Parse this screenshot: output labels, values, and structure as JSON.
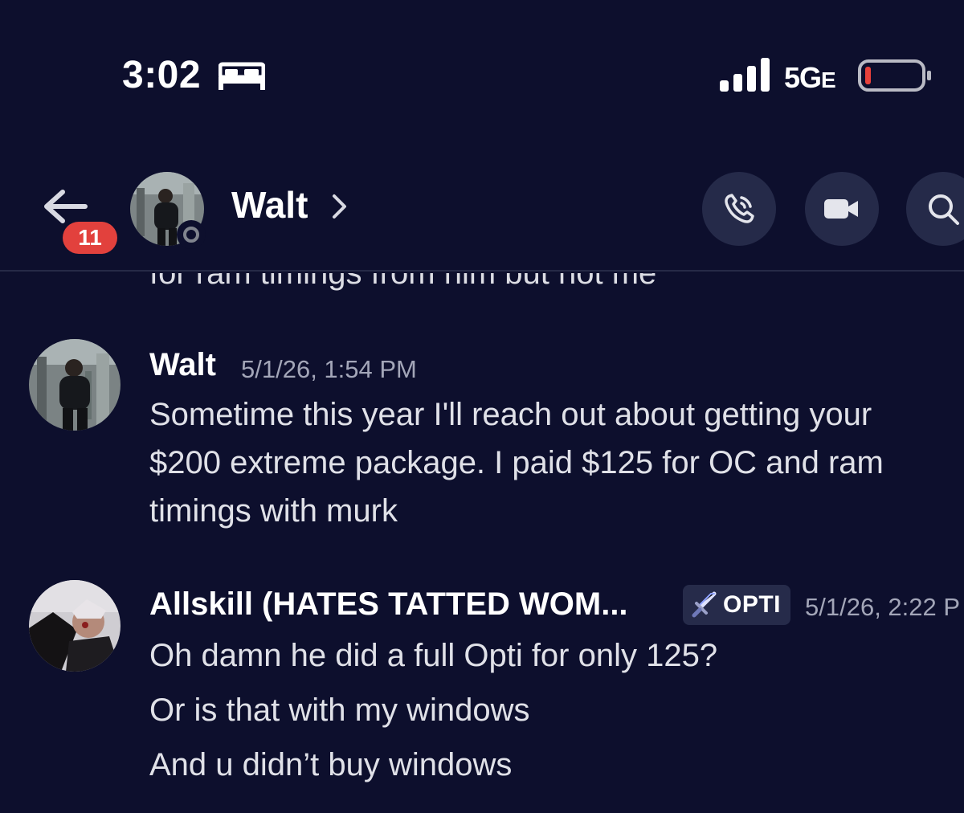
{
  "status_bar": {
    "time": "3:02",
    "sleep_icon": "bed-icon",
    "signal_icon": "cellular-signal-icon",
    "network": "5G",
    "network_suffix": "E",
    "battery_icon": "battery-low-icon",
    "battery_color": "#e8413b"
  },
  "header": {
    "back_icon": "back-arrow-icon",
    "unread_count": "11",
    "contact_name": "Walt",
    "chevron_icon": "chevron-right-icon",
    "presence": "offline",
    "call_icon": "phone-call-icon",
    "video_icon": "video-camera-icon",
    "search_icon": "search-icon"
  },
  "conversation": {
    "cut_off_line": "for ram timings from him but not me",
    "cut_off_emoji": "face-emoji",
    "messages": [
      {
        "author": "Walt",
        "timestamp": "5/1/26, 1:54 PM",
        "lines": [
          "Sometime this year I'll reach out about getting your",
          "$200 extreme package. I paid $125 for OC and ram",
          "timings with murk"
        ]
      },
      {
        "author": "Allskill (HATES TATTED WOM...",
        "role_tag": "OPTI",
        "role_icon": "sword-icon",
        "timestamp": "5/1/26, 2:22 P",
        "lines": [
          "Oh damn he did a full Opti for only 125?",
          "Or is that with my windows",
          "And u didn’t buy windows"
        ]
      }
    ]
  },
  "colors": {
    "background": "#0d0f2d",
    "badge": "#e2413d",
    "button_bg": "#252a49",
    "text_primary": "#ffffff",
    "text_muted": "#a3a6b8"
  }
}
